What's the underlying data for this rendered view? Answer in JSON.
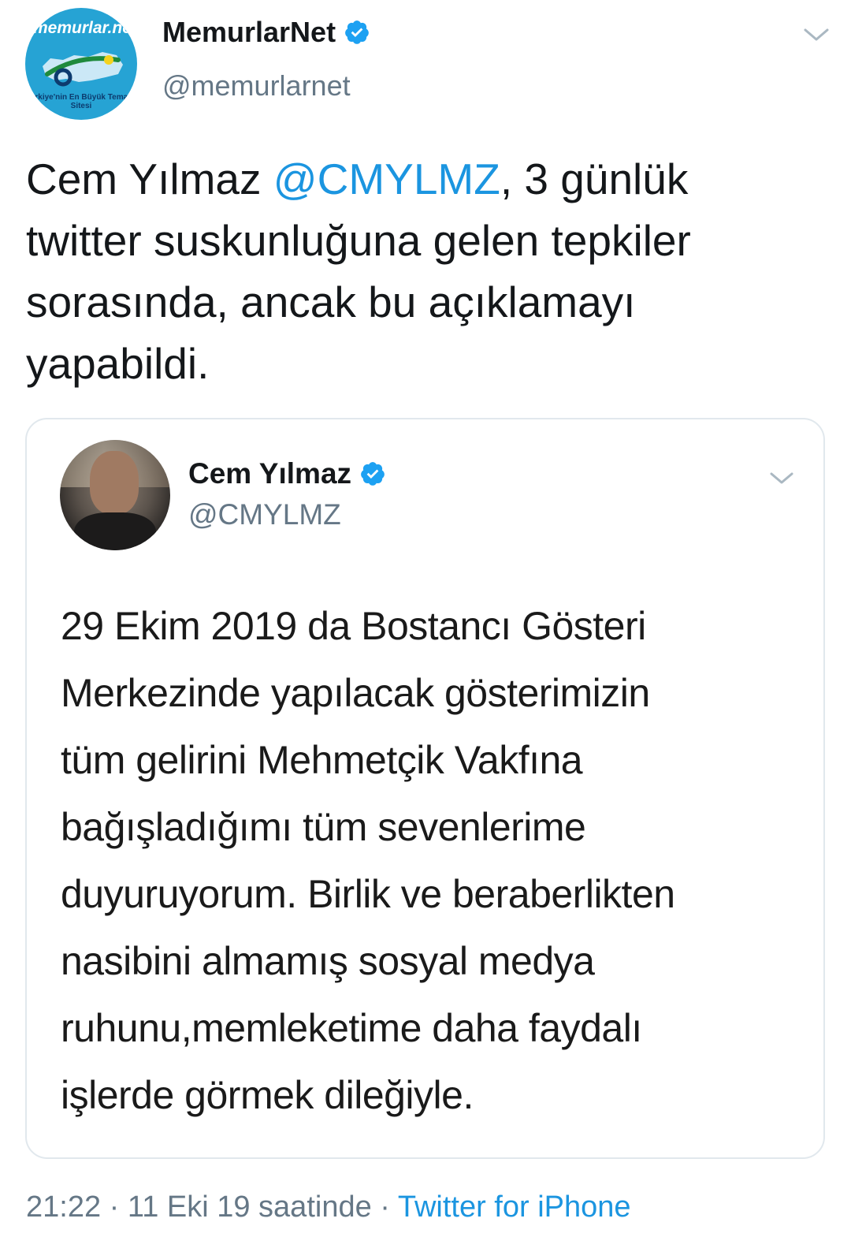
{
  "colors": {
    "text": "#14171a",
    "secondary": "#657786",
    "link": "#1b95e0",
    "verified": "#1da1f2",
    "border": "#e1e8ed"
  },
  "tweet": {
    "author_name": "MemurlarNet",
    "author_handle": "@memurlarnet",
    "avatar_logo_text": "memurlar.net",
    "avatar_tagline": "Türkiye'nin En Büyük Tematik Sitesi",
    "text_before_mention": "Cem Yılmaz ",
    "mention": "@CMYLMZ",
    "text_after_mention": ", 3 günlük twitter suskunluğuna gelen tepkiler sorasında, ancak bu açıklamayı yapabildi.",
    "verified_icon": "verified-badge-icon",
    "menu_icon": "chevron-down-icon"
  },
  "quoted_tweet": {
    "author_name": "Cem Yılmaz",
    "author_handle": "@CMYLMZ",
    "verified_icon": "verified-badge-icon",
    "menu_icon": "chevron-down-icon",
    "text_lines": [
      "29 Ekim 2019 da Bostancı  Gösteri",
      "Merkezinde yapılacak gösterimizin",
      "tüm gelirini Mehmetçik Vakfına",
      "bağışladığımı tüm sevenlerime",
      "duyuruyorum. Birlik ve beraberlikten",
      "nasibini almamış sosyal medya",
      "ruhunu,memleketime daha faydalı",
      "işlerde görmek dileğiyle."
    ]
  },
  "footer": {
    "time": "21:22",
    "separator1": " · ",
    "date": "11 Eki 19 saatinde",
    "separator2": " · ",
    "source": "Twitter for iPhone"
  }
}
